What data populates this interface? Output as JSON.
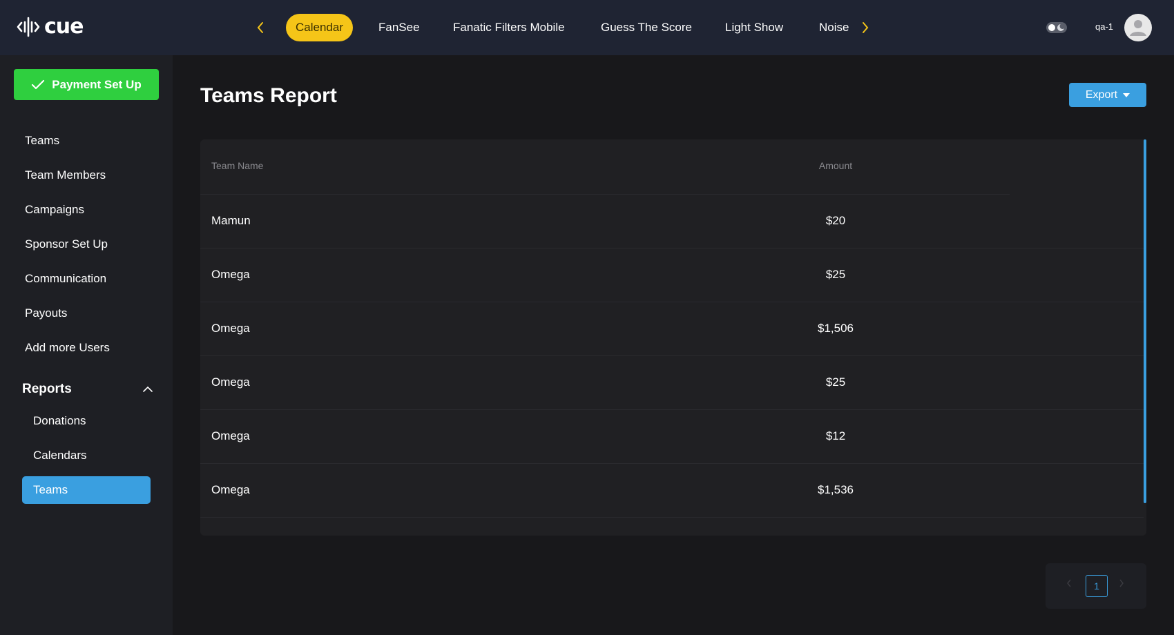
{
  "app": {
    "logo_text": "cue",
    "user_label": "qa-1"
  },
  "top_tabs": [
    {
      "label": "Calendar",
      "active": true
    },
    {
      "label": "FanSee"
    },
    {
      "label": "Fanatic Filters Mobile"
    },
    {
      "label": "Guess The Score"
    },
    {
      "label": "Light Show"
    },
    {
      "label": "Noise"
    }
  ],
  "sidebar": {
    "payment_button": "Payment Set Up",
    "items": [
      "Teams",
      "Team Members",
      "Campaigns",
      "Sponsor Set Up",
      "Communication",
      "Payouts",
      "Add more Users"
    ],
    "reports_label": "Reports",
    "report_items": [
      "Donations",
      "Calendars",
      "Teams"
    ],
    "active_item": "Teams"
  },
  "main": {
    "title": "Teams Report",
    "export_label": "Export",
    "table": {
      "headers": [
        "Team Name",
        "Amount"
      ],
      "rows": [
        {
          "name": "Mamun",
          "amount": "$20"
        },
        {
          "name": "Omega",
          "amount": "$25"
        },
        {
          "name": "Omega",
          "amount": "$1,506"
        },
        {
          "name": "Omega",
          "amount": "$25"
        },
        {
          "name": "Omega",
          "amount": "$12"
        },
        {
          "name": "Omega",
          "amount": "$1,536"
        }
      ]
    },
    "pagination": {
      "current_page": "1"
    }
  },
  "colors": {
    "accent": "#3a9fe0",
    "active_tab": "#f5c518",
    "success": "#2fcf3f",
    "topbar": "#1f2433"
  }
}
